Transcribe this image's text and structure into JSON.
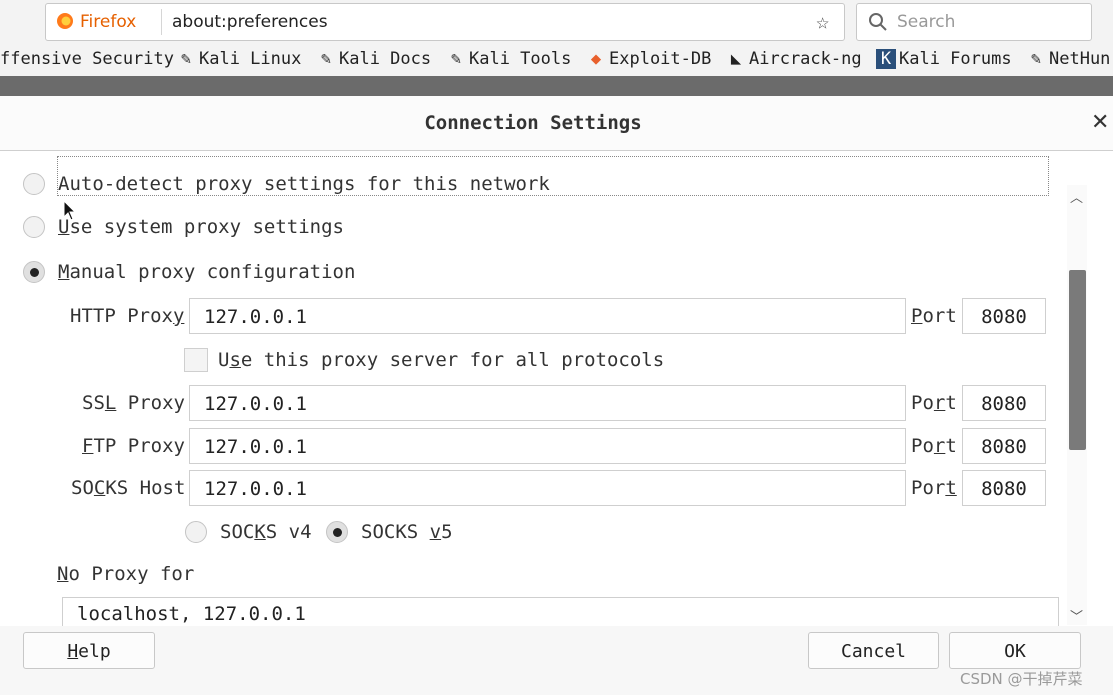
{
  "browser": {
    "brand": "Firefox",
    "url": "about:preferences",
    "search_placeholder": "Search",
    "bookmarks": [
      "ffensive Security",
      "Kali Linux",
      "Kali Docs",
      "Kali Tools",
      "Exploit-DB",
      "Aircrack-ng",
      "Kali Forums",
      "NetHun"
    ]
  },
  "dialog": {
    "title": "Connection Settings",
    "options": {
      "auto_detect": "Auto-detect proxy settings for this network",
      "system": {
        "pre": "",
        "accel": "U",
        "post": "se system proxy settings"
      },
      "manual": {
        "pre": "",
        "accel": "M",
        "post": "anual proxy configuration"
      }
    },
    "http": {
      "label_pre": "HTTP Prox",
      "label_accel": "y",
      "value": "127.0.0.1"
    },
    "use_all": {
      "pre": "U",
      "accel": "s",
      "post": "e this proxy server for all protocols"
    },
    "ssl": {
      "label_pre": "SS",
      "label_accel": "L",
      "label_post": " Proxy",
      "value": "127.0.0.1"
    },
    "ftp": {
      "label_pre": "",
      "label_accel": "F",
      "label_post": "TP Proxy",
      "value": "127.0.0.1"
    },
    "socks": {
      "label_pre": "SO",
      "label_accel": "C",
      "label_post": "KS Host",
      "value": "127.0.0.1"
    },
    "port": {
      "http": {
        "pre": "",
        "accel": "P",
        "post": "ort",
        "value": "8080"
      },
      "ssl": {
        "pre": "Po",
        "accel": "r",
        "post": "t",
        "value": "8080"
      },
      "ftp": {
        "pre": "Po",
        "accel": "r",
        "post": "t",
        "value": "8080"
      },
      "socks": {
        "pre": "Por",
        "accel": "t",
        "post": "",
        "value": "8080"
      }
    },
    "socks_v4": {
      "pre": "SOC",
      "accel": "K",
      "post": "S v4"
    },
    "socks_v5": {
      "pre": "SOCKS ",
      "accel": "v",
      "post": "5"
    },
    "no_proxy": {
      "pre": "",
      "accel": "N",
      "post": "o Proxy for",
      "value": "localhost, 127.0.0.1"
    },
    "buttons": {
      "help_accel": "H",
      "help_post": "elp",
      "cancel": "Cancel",
      "ok": "OK"
    }
  },
  "watermark": "CSDN @干掉芹菜"
}
